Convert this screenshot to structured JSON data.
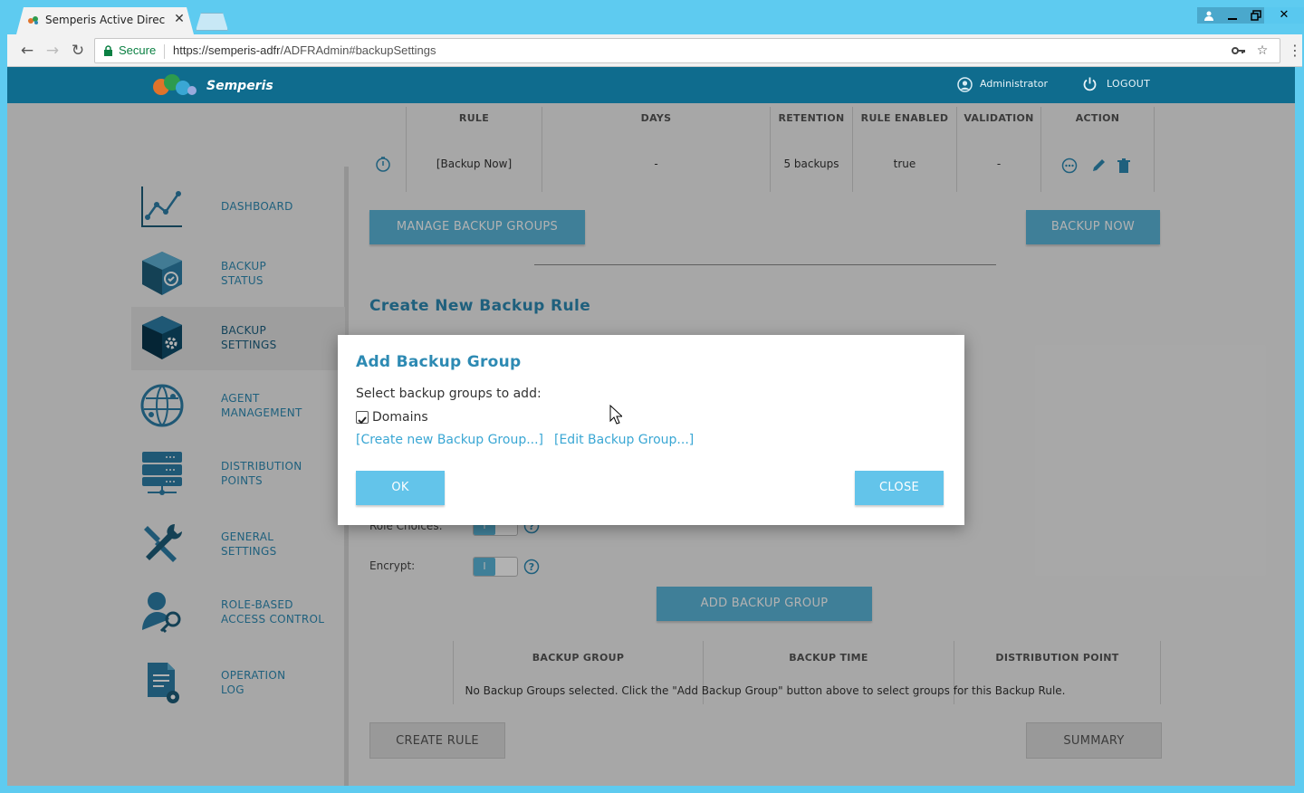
{
  "browser": {
    "tab_title": "Semperis Active Directory",
    "secure_label": "Secure",
    "url_host": "https://semperis-adfr",
    "url_path": "/ADFRAdmin#backupSettings",
    "window_controls": [
      "user-icon",
      "minimize-icon",
      "restore-icon",
      "close-icon"
    ]
  },
  "header": {
    "brand": "Semperis",
    "user": "Administrator",
    "logout": "LOGOUT"
  },
  "sidebar": {
    "items": [
      {
        "line1": "DASHBOARD",
        "line2": "",
        "icon": "dashboard-chart-icon"
      },
      {
        "line1": "BACKUP",
        "line2": "STATUS",
        "icon": "backup-status-cube-icon"
      },
      {
        "line1": "BACKUP",
        "line2": "SETTINGS",
        "icon": "backup-settings-cube-icon"
      },
      {
        "line1": "AGENT",
        "line2": "MANAGEMENT",
        "icon": "agent-globe-icon"
      },
      {
        "line1": "DISTRIBUTION",
        "line2": "POINTS",
        "icon": "server-rack-icon"
      },
      {
        "line1": "GENERAL",
        "line2": "SETTINGS",
        "icon": "wrench-screwdriver-icon"
      },
      {
        "line1": "ROLE-BASED",
        "line2": "ACCESS CONTROL",
        "icon": "user-key-icon"
      },
      {
        "line1": "OPERATION",
        "line2": "LOG",
        "icon": "document-gear-icon"
      }
    ],
    "active_index": 2
  },
  "rules_table": {
    "headers": [
      "RULE",
      "DAYS",
      "RETENTION",
      "RULE ENABLED",
      "VALIDATION",
      "ACTION"
    ],
    "row": [
      "[Backup Now]",
      "-",
      "5 backups",
      "true",
      "-"
    ]
  },
  "buttons": {
    "manage_groups": "MANAGE BACKUP GROUPS",
    "backup_now": "BACKUP NOW",
    "add_group": "ADD BACKUP GROUP",
    "create_rule": "CREATE RULE",
    "summary": "SUMMARY"
  },
  "form": {
    "section_title": "Create New Backup Rule",
    "role_choices_label": "Role Choices:",
    "encrypt_label": "Encrypt:",
    "toggle_on": "I"
  },
  "groups_table": {
    "headers": [
      "BACKUP GROUP",
      "BACKUP TIME",
      "DISTRIBUTION POINT"
    ],
    "empty_message": "No Backup Groups selected. Click the \"Add Backup Group\" button above to select groups for this Backup Rule."
  },
  "modal": {
    "title": "Add Backup Group",
    "subtitle": "Select backup groups to add:",
    "checkbox_label": "Domains",
    "checkbox_checked": true,
    "create_link": "[Create new Backup Group...]",
    "edit_link": "[Edit Backup Group...]",
    "ok": "OK",
    "close": "CLOSE"
  },
  "colors": {
    "accent": "#2d8ab3",
    "button": "#5bb6da",
    "appbar": "#0f6c8e",
    "chrome": "#5ecbf0"
  }
}
